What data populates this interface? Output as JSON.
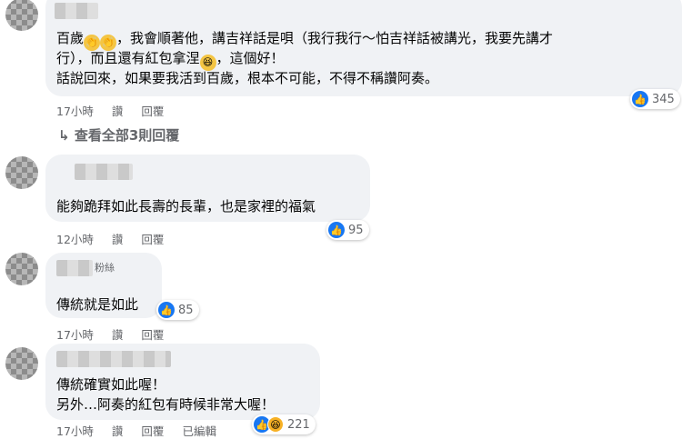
{
  "comments": [
    {
      "lines": [
        "百歲",
        "，我會順著他，講吉祥話是唄（我行我行～怕吉祥話被講光，我要先講才",
        "行），而且還有紅包拿涅",
        "，這個好！",
        "話說回來，如果要我活到百歲，根本不可能，不得不稱讚阿奏。"
      ],
      "time": "17小時",
      "like": "讚",
      "reply": "回覆",
      "reactions": "345"
    },
    {
      "view_all": "查看全部3則回覆"
    },
    {
      "text": "能夠跪拜如此長壽的長輩，也是家裡的福氣",
      "time": "12小時",
      "like": "讚",
      "reply": "回覆",
      "reactions": "95"
    },
    {
      "badge": "粉絲",
      "text": "傳統就是如此",
      "time": "17小時",
      "like": "讚",
      "reply": "回覆",
      "reactions": "85"
    },
    {
      "lines": [
        "傳統確實如此喔！",
        "另外…阿奏的紅包有時候非常大喔！"
      ],
      "time": "17小時",
      "like": "讚",
      "reply": "回覆",
      "edited": "已編輯",
      "reactions": "221"
    }
  ],
  "colors": {
    "bubble": "#f0f2f5",
    "like_blue": "#1877f2",
    "meta_gray": "#65676b"
  },
  "icons": [
    "clap-emoji",
    "laugh-emoji",
    "like-icon",
    "haha-icon",
    "reply-arrow-icon"
  ]
}
